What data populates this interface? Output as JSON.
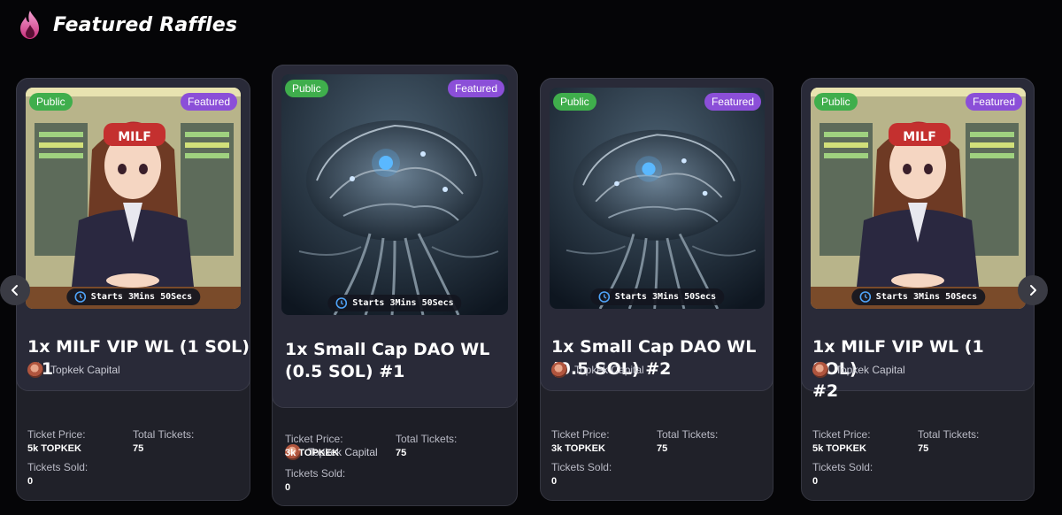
{
  "header": {
    "title": "Featured Raffles",
    "icon": "flame-icon",
    "accent": "#e03c8a"
  },
  "colors": {
    "public_badge": "#3fae4c",
    "featured_badge": "#8b4fd8",
    "background": "#050507"
  },
  "carousel": {
    "prev_icon": "chevron-left-icon",
    "next_icon": "chevron-right-icon",
    "cards": [
      {
        "art": "milf-girl",
        "badges": {
          "public": "Public",
          "featured": "Featured"
        },
        "timer": "Starts 3Mins 50Secs",
        "title_line1": "1x MILF VIP WL (1 SOL)",
        "title_line2": "#1",
        "creator": "Topkek Capital",
        "price_label": "Ticket Price:",
        "price_value": "5k TOPKEK",
        "total_label": "Total Tickets:",
        "total_value": "75",
        "sold_label": "Tickets Sold:",
        "sold_value": "0"
      },
      {
        "art": "brain",
        "badges": {
          "public": "Public",
          "featured": "Featured"
        },
        "timer": "Starts 3Mins 50Secs",
        "title_line1": "1x Small Cap DAO WL",
        "title_line2": "(0.5 SOL) #1",
        "creator": "Topkek Capital",
        "price_label": "Ticket Price:",
        "price_value": "3k TOPKEK",
        "total_label": "Total Tickets:",
        "total_value": "75",
        "sold_label": "Tickets Sold:",
        "sold_value": "0"
      },
      {
        "art": "brain",
        "badges": {
          "public": "Public",
          "featured": "Featured"
        },
        "timer": "Starts 3Mins 50Secs",
        "title_line1": "1x Small Cap DAO WL",
        "title_line2": "(0.5 SOL) #2",
        "creator": "Topkek Capital",
        "price_label": "Ticket Price:",
        "price_value": "3k TOPKEK",
        "total_label": "Total Tickets:",
        "total_value": "75",
        "sold_label": "Tickets Sold:",
        "sold_value": "0"
      },
      {
        "art": "milf-girl",
        "badges": {
          "public": "Public",
          "featured": "Featured"
        },
        "timer": "Starts 3Mins 50Secs",
        "title_line1": "1x MILF VIP WL (1 SOL)",
        "title_line2": "#2",
        "creator": "Topkek Capital",
        "price_label": "Ticket Price:",
        "price_value": "5k TOPKEK",
        "total_label": "Total Tickets:",
        "total_value": "75",
        "sold_label": "Tickets Sold:",
        "sold_value": "0"
      }
    ]
  },
  "milf_cap_text": "MILF"
}
